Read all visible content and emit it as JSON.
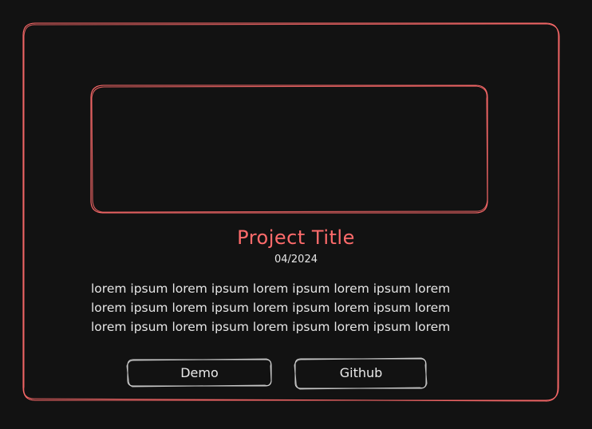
{
  "card": {
    "title": "Project Title",
    "date": "04/2024",
    "description": "lorem ipsum lorem ipsum lorem ipsum lorem ipsum lorem\nlorem ipsum lorem ipsum lorem ipsum lorem ipsum lorem\nlorem ipsum lorem ipsum lorem ipsum lorem ipsum lorem",
    "buttons": {
      "demo_label": "Demo",
      "github_label": "Github"
    }
  },
  "colors": {
    "background": "#121212",
    "accent": "#ff6b6b",
    "text": "#e6e6e6",
    "button_stroke": "#d8d8d8"
  }
}
